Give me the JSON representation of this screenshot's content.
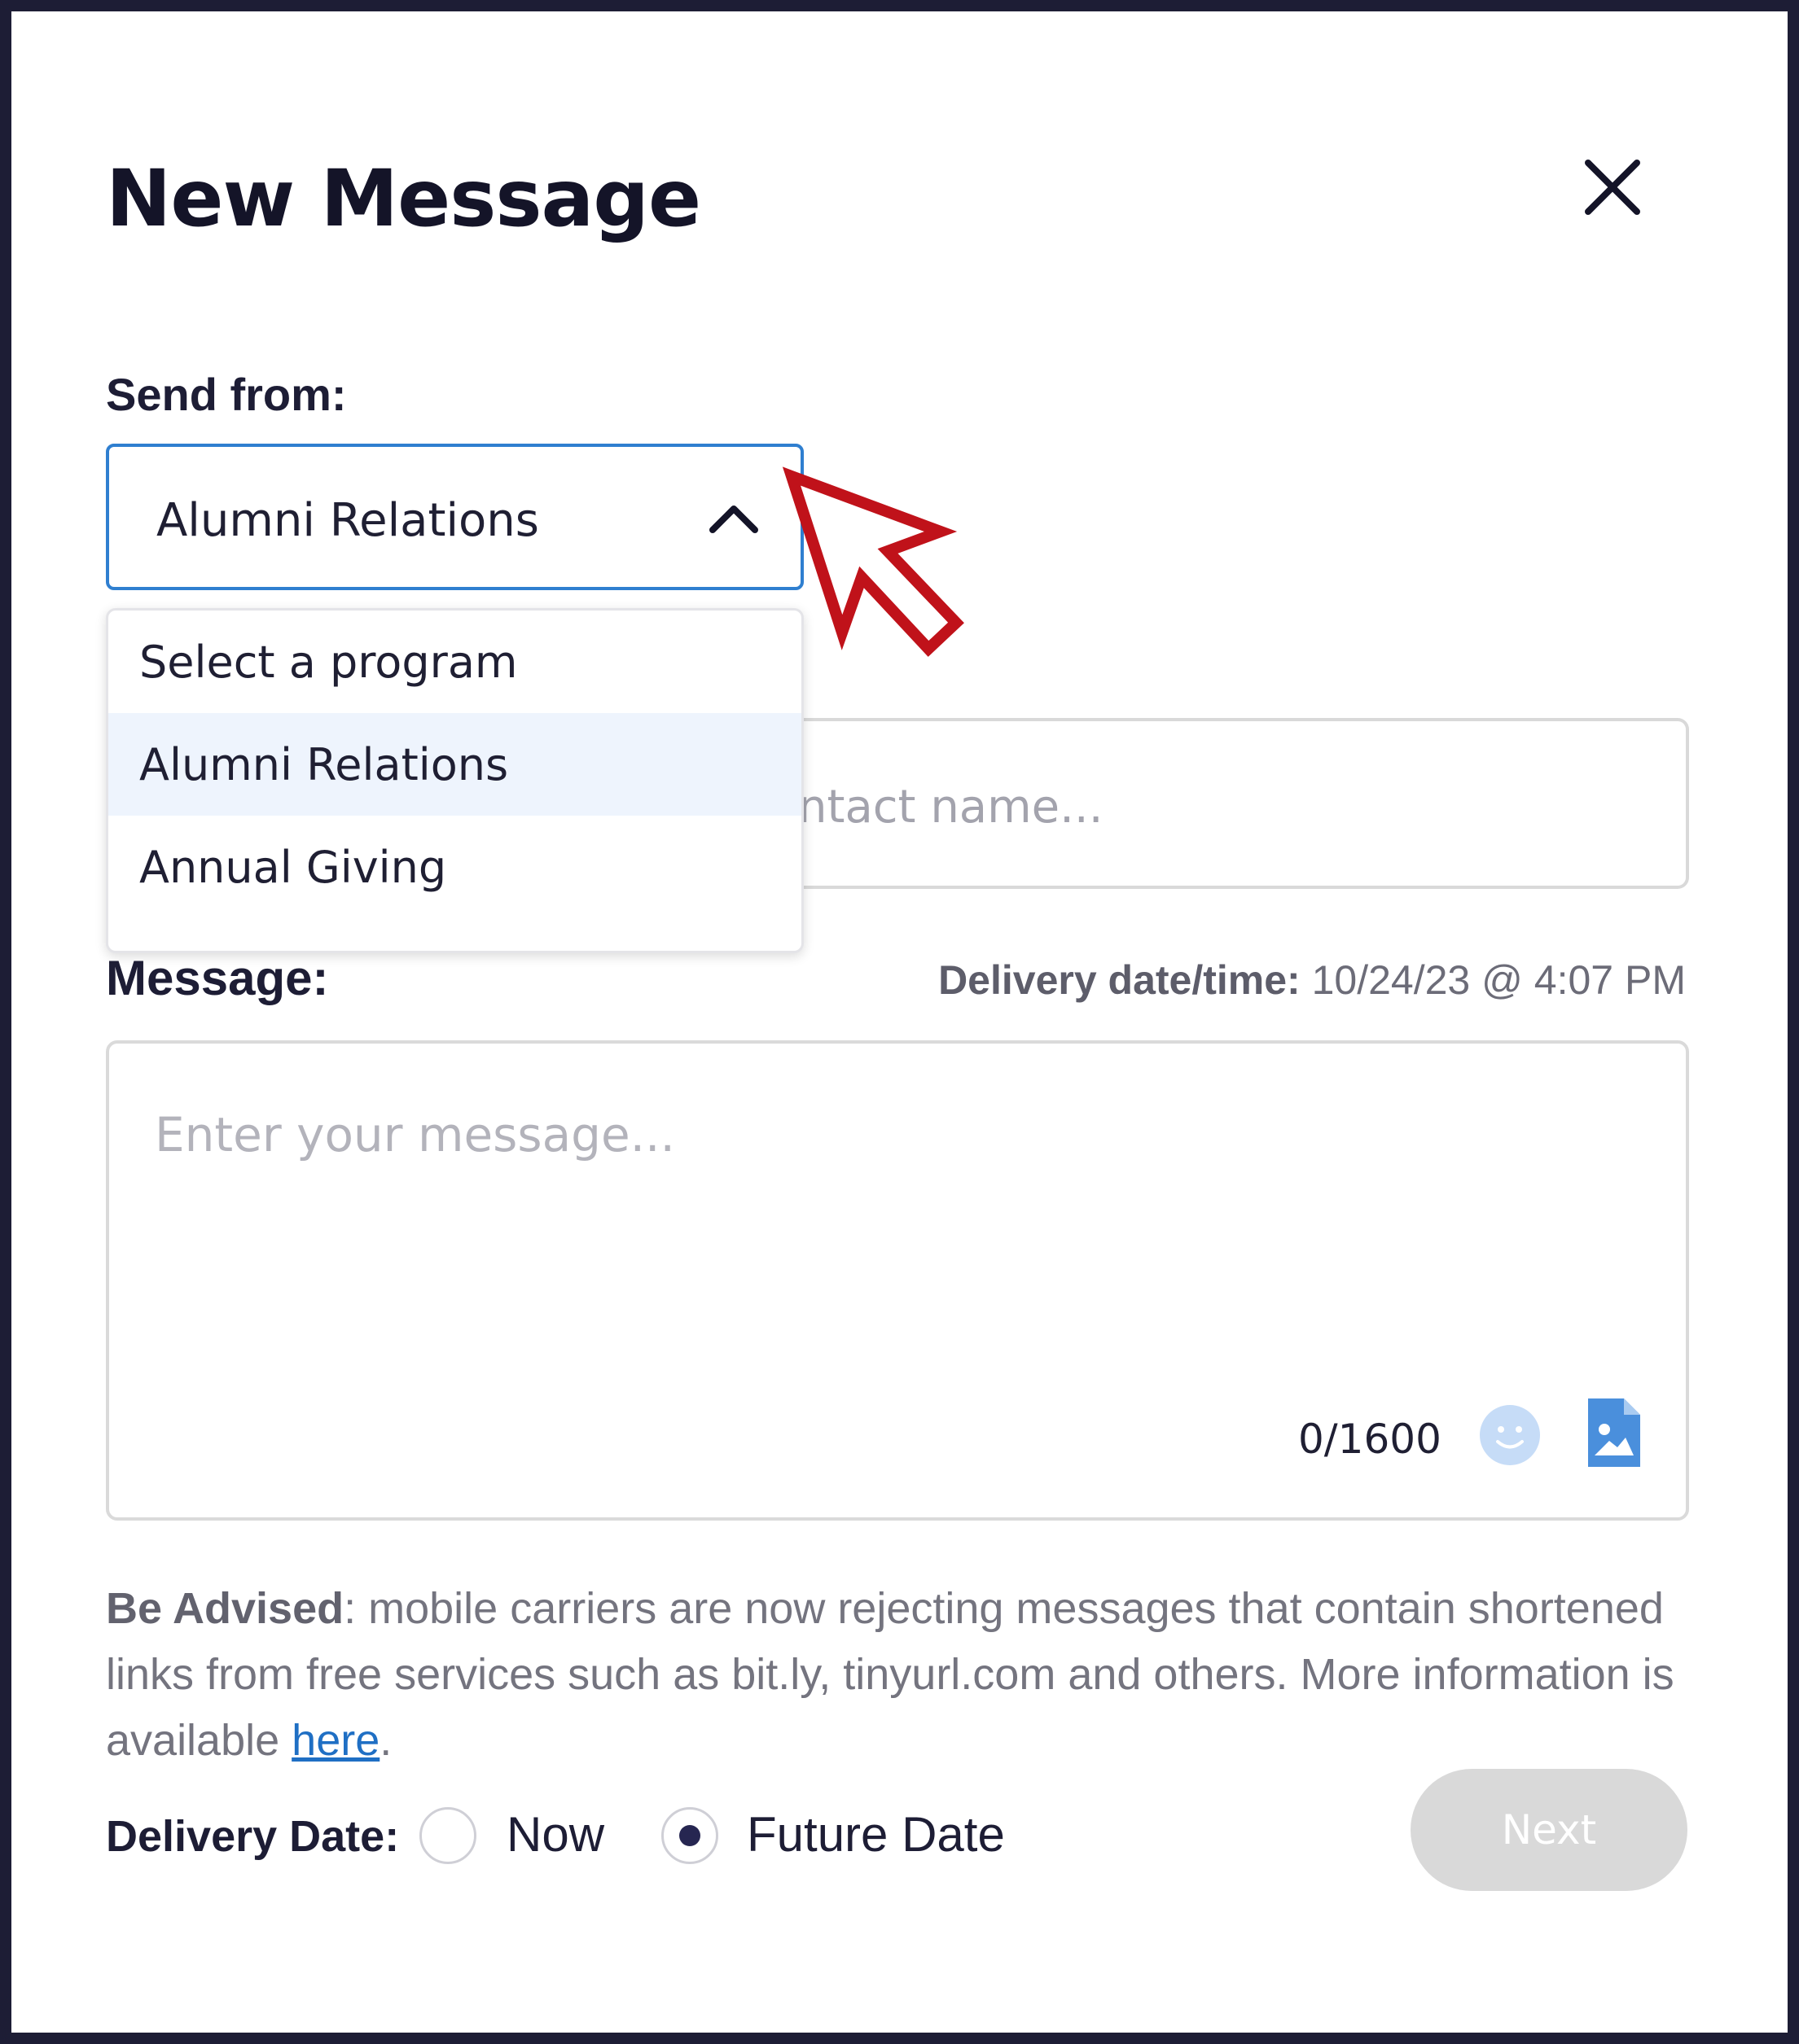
{
  "dialog": {
    "title": "New Message",
    "close_icon": "close-icon"
  },
  "send_from": {
    "label": "Send from:",
    "selected_value": "Alumni Relations",
    "expanded": true,
    "options": [
      {
        "label": "Select a program",
        "selected": false
      },
      {
        "label": "Alumni Relations",
        "selected": true
      },
      {
        "label": "Annual Giving",
        "selected": false
      }
    ]
  },
  "to_field": {
    "visible_placeholder": "ntact name..."
  },
  "message": {
    "label": "Message:",
    "placeholder": "Enter your message...",
    "counter": "0/1600",
    "delivery_label": "Delivery date/time:",
    "delivery_value": " 10/24/23 @ 4:07 PM",
    "emoji_icon": "smiley-icon",
    "image_icon": "image-file-icon"
  },
  "advisory": {
    "strong": "Be Advised",
    "text": ": mobile carriers are now rejecting messages that contain shortened links from free services such as bit.ly, tinyurl.com and others. More information is available ",
    "link_text": "here",
    "end": "."
  },
  "delivery_date": {
    "label": "Delivery Date:",
    "options": [
      {
        "label": "Now",
        "selected": false
      },
      {
        "label": "Future Date",
        "selected": true
      }
    ]
  },
  "next_button": {
    "label": "Next",
    "disabled": true
  },
  "colors": {
    "accent_border": "#2f7fd0",
    "link": "#1f6fc4",
    "dropdown_highlight": "#eef4fd",
    "radio_selected": "#262651",
    "next_disabled": "#d9d9d9",
    "cursor_annotation": "#c0121a"
  },
  "annotation": {
    "icon": "pointer-arrow-icon"
  }
}
